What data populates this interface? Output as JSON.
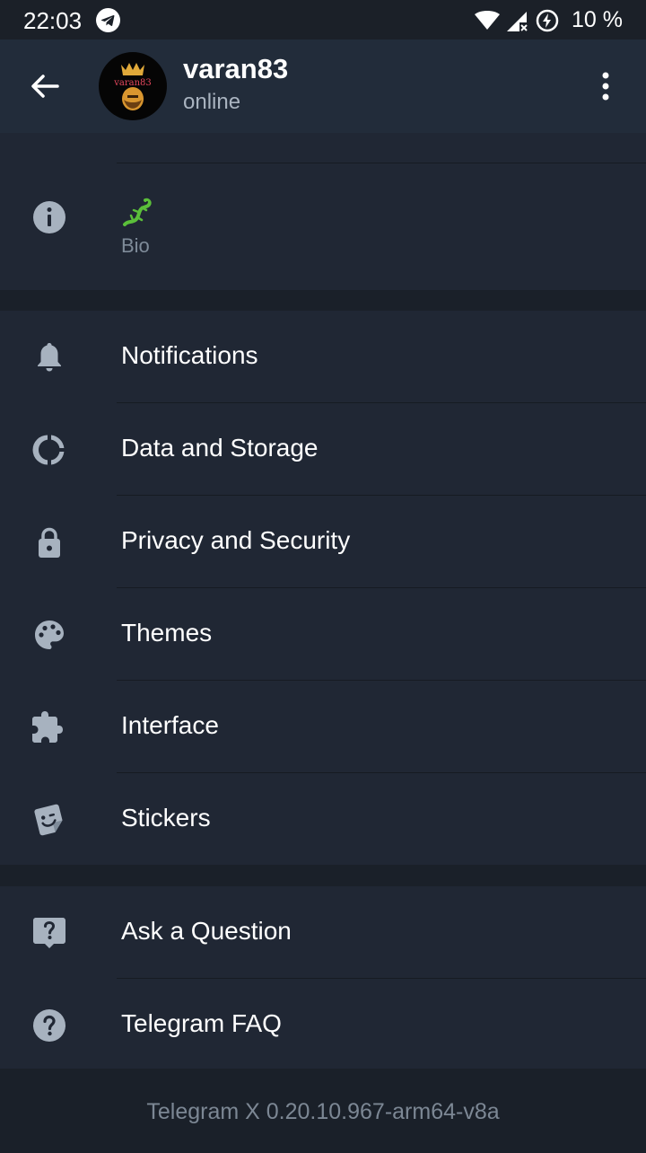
{
  "status_bar": {
    "time": "22:03",
    "battery": "10 %",
    "icons": [
      "telegram-icon",
      "wifi-icon",
      "signal-icon",
      "battery-charging-icon"
    ]
  },
  "header": {
    "name": "varan83",
    "status": "online",
    "avatar_text": "varan83"
  },
  "profile": {
    "bio_label": "Bio"
  },
  "menu": [
    {
      "label": "Notifications",
      "icon": "bell-icon"
    },
    {
      "label": "Data and Storage",
      "icon": "data-storage-icon"
    },
    {
      "label": "Privacy and Security",
      "icon": "lock-icon"
    },
    {
      "label": "Themes",
      "icon": "palette-icon"
    },
    {
      "label": "Interface",
      "icon": "puzzle-icon"
    },
    {
      "label": "Stickers",
      "icon": "sticker-icon"
    }
  ],
  "help": [
    {
      "label": "Ask a Question",
      "icon": "question-bubble-icon"
    },
    {
      "label": "Telegram FAQ",
      "icon": "help-circle-icon"
    }
  ],
  "footer": {
    "version": "Telegram X 0.20.10.967-arm64-v8a"
  },
  "colors": {
    "background": "#1a2029",
    "header": "#222c3a",
    "card": "#202734",
    "icon": "#a7b2bf",
    "text": "#ffffff",
    "secondary": "#7e8b99"
  }
}
